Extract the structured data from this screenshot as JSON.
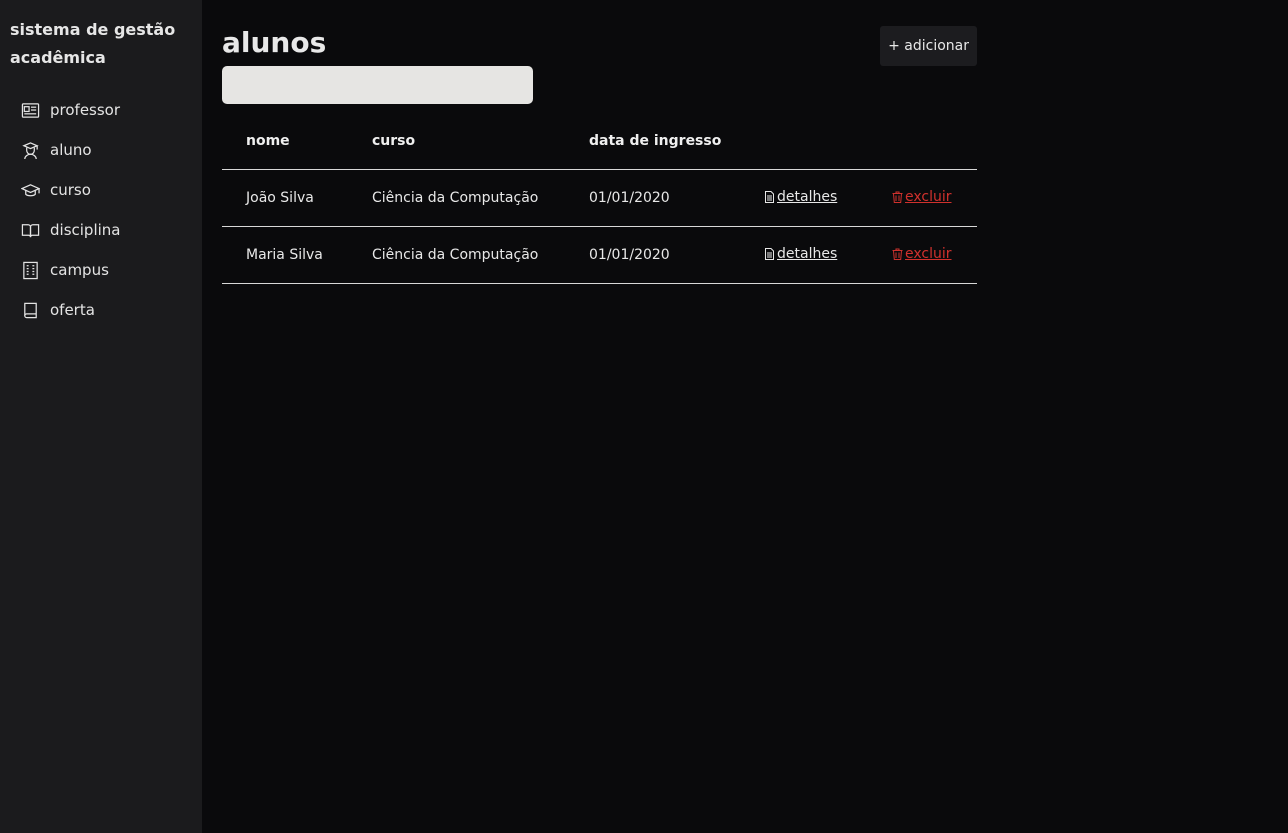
{
  "app": {
    "title": "sistema de gestão acadêmica"
  },
  "sidebar": {
    "items": [
      {
        "label": "professor",
        "icon": "id-card-icon"
      },
      {
        "label": "aluno",
        "icon": "student-icon"
      },
      {
        "label": "curso",
        "icon": "graduation-cap-icon"
      },
      {
        "label": "disciplina",
        "icon": "open-book-icon"
      },
      {
        "label": "campus",
        "icon": "building-icon"
      },
      {
        "label": "oferta",
        "icon": "book-icon"
      }
    ]
  },
  "main": {
    "title": "alunos",
    "add_label": "+ adicionar",
    "search": {
      "value": "",
      "placeholder": ""
    },
    "table": {
      "headers": [
        "nome",
        "curso",
        "data de ingresso"
      ],
      "rows": [
        {
          "nome": "João Silva",
          "curso": "Ciência da Computação",
          "data": "01/01/2020",
          "details_label": "detalhes",
          "delete_label": "excluir"
        },
        {
          "nome": "Maria Silva",
          "curso": "Ciência da Computação",
          "data": "01/01/2020",
          "details_label": "detalhes",
          "delete_label": "excluir"
        }
      ]
    }
  },
  "colors": {
    "background": "#0a0a0c",
    "sidebar": "#1b1b1d",
    "danger": "#d0312d",
    "search_bg": "#e6e5e3"
  }
}
